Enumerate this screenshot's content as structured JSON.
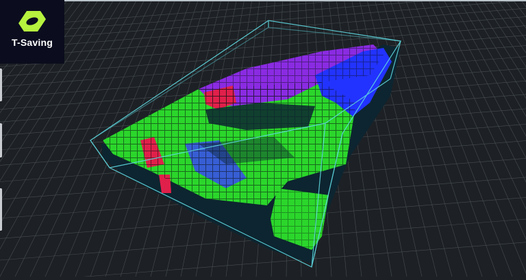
{
  "app": {
    "name": "T-Saving",
    "dot_color": "#3fe0c0"
  },
  "logo": {
    "icon": "hexagon-logo-icon",
    "color": "#b6f23e"
  },
  "viewport": {
    "background": "#1d2125",
    "grid_color": "#5a6066",
    "bbox_color": "#5fd8e0",
    "scan_colors": {
      "floor": "#2bd62b",
      "roof": "#8a2be2",
      "wall": "#2233ff",
      "edge": "#e0204a"
    }
  }
}
